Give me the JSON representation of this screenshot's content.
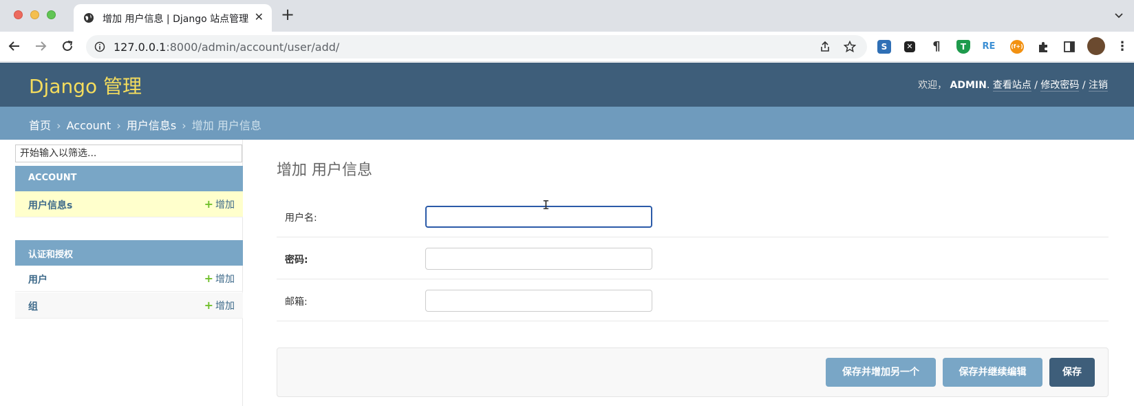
{
  "browser": {
    "tab_title": "增加 用户信息 | Django 站点管理",
    "url_host": "127.0.0.1",
    "url_rest": ":8000/admin/account/user/add/"
  },
  "header": {
    "brand": "Django 管理",
    "welcome": "欢迎，",
    "username": "ADMIN",
    "period": ".",
    "view_site": "查看站点",
    "change_password": "修改密码",
    "logout": "注销",
    "sep": " / "
  },
  "breadcrumbs": {
    "home": "首页",
    "app": "Account",
    "model": "用户信息s",
    "current": "增加 用户信息",
    "arrow": "›"
  },
  "sidebar": {
    "filter_placeholder": "开始输入以筛选...",
    "modules": [
      {
        "caption": "ACCOUNT",
        "models": [
          {
            "name": "用户信息s",
            "add": "增加"
          }
        ]
      },
      {
        "caption": "认证和授权",
        "models": [
          {
            "name": "用户",
            "add": "增加"
          },
          {
            "name": "组",
            "add": "增加"
          }
        ]
      }
    ]
  },
  "main": {
    "title": "增加 用户信息",
    "fields": [
      {
        "label": "用户名:",
        "value": ""
      },
      {
        "label": "密码:",
        "value": ""
      },
      {
        "label": "邮箱:",
        "value": ""
      }
    ],
    "buttons": {
      "save_add_another": "保存并增加另一个",
      "save_continue": "保存并继续编辑",
      "save": "保存"
    }
  },
  "colors": {
    "header_bg": "#3e5e7a",
    "breadcrumb_bg": "#6f9bbd",
    "module_caption_bg": "#79a6c6",
    "brand_yellow": "#f5dd5d",
    "add_green": "#70bf2b",
    "selected_row": "#ffffcc"
  },
  "icons": [
    "globe-icon",
    "close-icon",
    "plus-icon",
    "back-icon",
    "forward-icon",
    "reload-icon",
    "info-icon",
    "share-icon",
    "star-icon",
    "puzzle-icon",
    "sidepanel-icon",
    "avatar"
  ]
}
